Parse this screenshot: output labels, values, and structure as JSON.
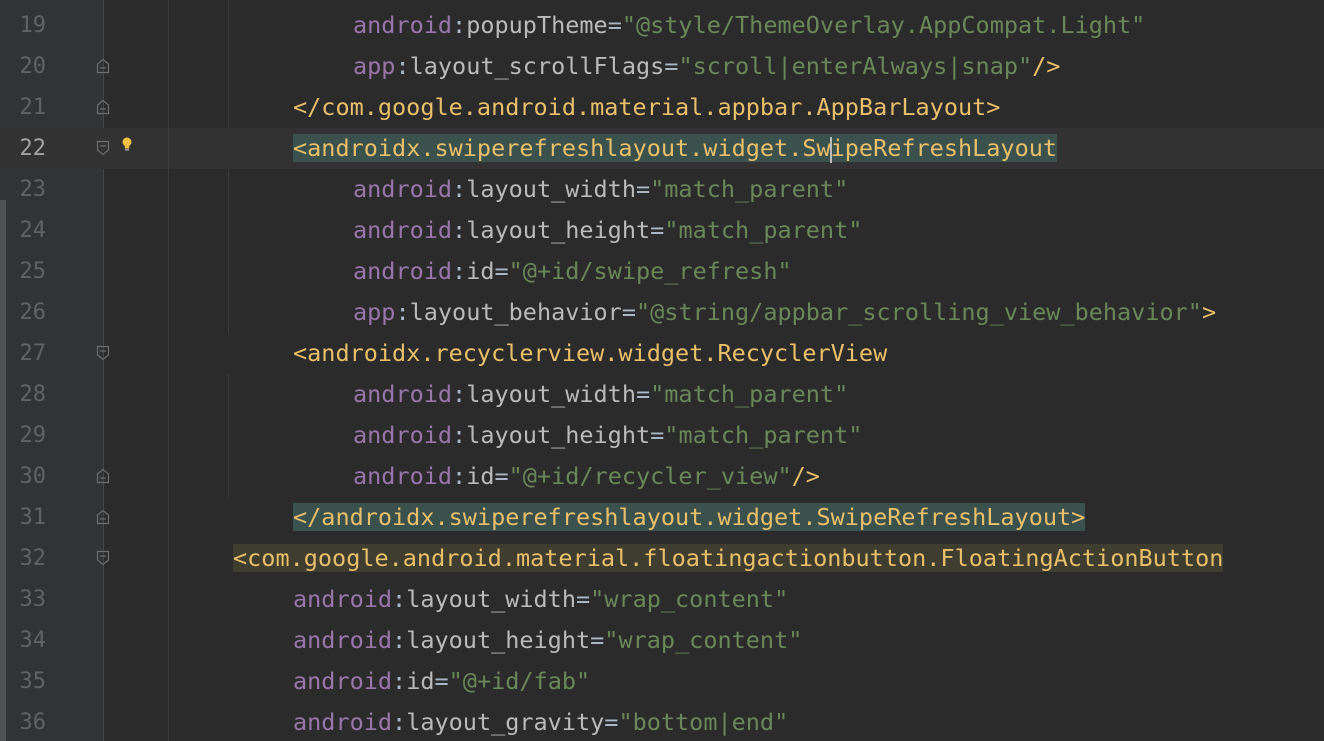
{
  "editor": {
    "current_line": 22,
    "lines": [
      {
        "no": "19",
        "indent": "4",
        "kind": "attr",
        "ns": "android",
        "attr": "popupTheme",
        "eq": "=",
        "val": "\"@style/ThemeOverlay.AppCompat.Light\"",
        "end": ""
      },
      {
        "no": "20",
        "indent": "4",
        "kind": "attr",
        "ns": "app",
        "attr": "layout_scrollFlags",
        "eq": "=",
        "val": "\"scroll|enterAlways|snap\"",
        "end": "/>"
      },
      {
        "no": "21",
        "indent": "3",
        "kind": "tag",
        "open": "</",
        "tag": "com.google.android.material.appbar.AppBarLayout",
        "close": ">"
      },
      {
        "no": "22",
        "indent": "3",
        "kind": "tag-caret",
        "open": "<",
        "tag_a": "androidx.swiperefreshlayout.widget.Sw",
        "tag_b": "ipeRefreshLayout",
        "close": ""
      },
      {
        "no": "23",
        "indent": "4",
        "kind": "attr",
        "ns": "android",
        "attr": "layout_width",
        "eq": "=",
        "val": "\"match_parent\"",
        "end": ""
      },
      {
        "no": "24",
        "indent": "4",
        "kind": "attr",
        "ns": "android",
        "attr": "layout_height",
        "eq": "=",
        "val": "\"match_parent\"",
        "end": ""
      },
      {
        "no": "25",
        "indent": "4",
        "kind": "attr",
        "ns": "android",
        "attr": "id",
        "eq": "=",
        "val": "\"@+id/swipe_refresh\"",
        "end": ""
      },
      {
        "no": "26",
        "indent": "4",
        "kind": "attr",
        "ns": "app",
        "attr": "layout_behavior",
        "eq": "=",
        "val": "\"@string/appbar_scrolling_view_behavior\"",
        "end": ">"
      },
      {
        "no": "27",
        "indent": "3",
        "kind": "tag",
        "open": "<",
        "tag": "androidx.recyclerview.widget.RecyclerView",
        "close": ""
      },
      {
        "no": "28",
        "indent": "4",
        "kind": "attr",
        "ns": "android",
        "attr": "layout_width",
        "eq": "=",
        "val": "\"match_parent\"",
        "end": ""
      },
      {
        "no": "29",
        "indent": "4",
        "kind": "attr",
        "ns": "android",
        "attr": "layout_height",
        "eq": "=",
        "val": "\"match_parent\"",
        "end": ""
      },
      {
        "no": "30",
        "indent": "4",
        "kind": "attr",
        "ns": "android",
        "attr": "id",
        "eq": "=",
        "val": "\"@+id/recycler_view\"",
        "end": "/>"
      },
      {
        "no": "31",
        "indent": "3",
        "kind": "tag",
        "open": "</",
        "tag": "androidx.swiperefreshlayout.widget.SwipeRefreshLayout",
        "close": ">"
      },
      {
        "no": "32",
        "indent": "2",
        "kind": "tag",
        "open": "<",
        "tag": "com.google.android.material.floatingactionbutton.FloatingActionButton",
        "close": ""
      },
      {
        "no": "33",
        "indent": "3",
        "kind": "attr",
        "ns": "android",
        "attr": "layout_width",
        "eq": "=",
        "val": "\"wrap_content\"",
        "end": ""
      },
      {
        "no": "34",
        "indent": "3",
        "kind": "attr",
        "ns": "android",
        "attr": "layout_height",
        "eq": "=",
        "val": "\"wrap_content\"",
        "end": ""
      },
      {
        "no": "35",
        "indent": "3",
        "kind": "attr",
        "ns": "android",
        "attr": "id",
        "eq": "=",
        "val": "\"@+id/fab\"",
        "end": ""
      },
      {
        "no": "36",
        "indent": "3",
        "kind": "attr",
        "ns": "android",
        "attr": "layout_gravity",
        "eq": "=",
        "val": "\"bottom|end\"",
        "end": ""
      }
    ],
    "fold_markers": [
      {
        "line": "20",
        "type": "end"
      },
      {
        "line": "21",
        "type": "end"
      },
      {
        "line": "22",
        "type": "start"
      },
      {
        "line": "27",
        "type": "start"
      },
      {
        "line": "30",
        "type": "end"
      },
      {
        "line": "31",
        "type": "end"
      },
      {
        "line": "32",
        "type": "start"
      }
    ],
    "intention_bulb": {
      "line": "22",
      "icon": "lightbulb-icon"
    }
  },
  "colors": {
    "background": "#2b2b2b",
    "gutter": "#313335",
    "tag": "#e8bf6a",
    "namespace": "#9876aa",
    "attribute": "#bababa",
    "string": "#6a8759",
    "punctuation": "#a9b7c6",
    "tag_match_highlight": "#3b514d",
    "fab_highlight": "#3f3d2f"
  }
}
